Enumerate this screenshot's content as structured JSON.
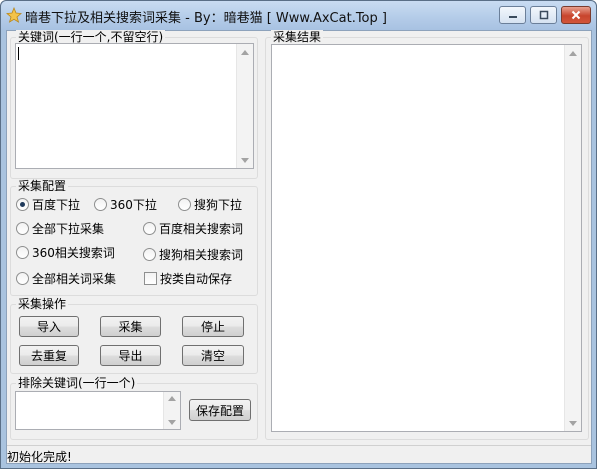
{
  "window": {
    "title": "暗巷下拉及相关搜索词采集 - By：暗巷猫 [ Www.AxCat.Top ]",
    "controls": [
      "minimize-icon",
      "maximize-icon",
      "close-icon"
    ]
  },
  "keywords": {
    "label": "关键词(一行一个,不留空行)",
    "value": ""
  },
  "config": {
    "label": "采集配置",
    "options": [
      {
        "label": "百度下拉",
        "selected": true
      },
      {
        "label": "360下拉",
        "selected": false
      },
      {
        "label": "搜狗下拉",
        "selected": false
      },
      {
        "label": "全部下拉采集",
        "selected": false
      },
      {
        "label": "百度相关搜索词",
        "selected": false
      },
      {
        "label": "360相关搜索词",
        "selected": false
      },
      {
        "label": "搜狗相关搜索词",
        "selected": false
      },
      {
        "label": "全部相关词采集",
        "selected": false
      }
    ],
    "save_by_type": {
      "label": "按类自动保存",
      "checked": false
    }
  },
  "actions": {
    "label": "采集操作",
    "import": "导入",
    "collect": "采集",
    "stop": "停止",
    "dedupe": "去重复",
    "export": "导出",
    "clear": "清空"
  },
  "exclude": {
    "label": "排除关键词(一行一个)",
    "value": "",
    "save_button": "保存配置"
  },
  "results": {
    "label": "采集结果",
    "value": ""
  },
  "status": {
    "text": "初始化完成!"
  },
  "colors": {
    "title_bar": "#b3cbe8",
    "frame": "#a9c3df",
    "client_bg": "#f0f0f0",
    "close_button": "#c8452d"
  }
}
